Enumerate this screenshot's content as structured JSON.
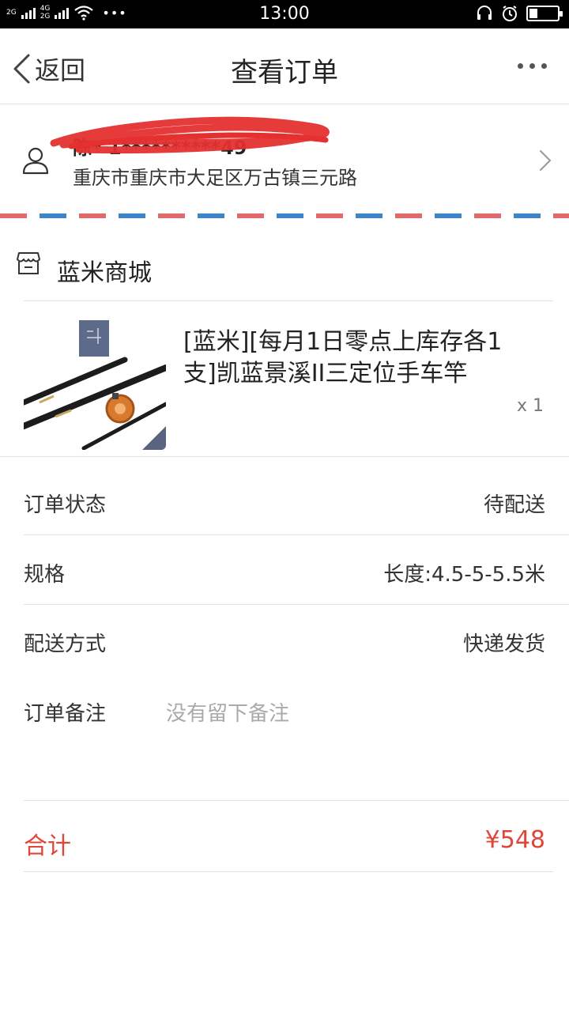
{
  "status_bar": {
    "time": "13:00",
    "net_top": "2G",
    "net2_top": "4G",
    "net2_bottom": "2G",
    "dots": "•••",
    "battery_level": 0.3
  },
  "nav": {
    "back_label": "返回",
    "title": "查看订单"
  },
  "address": {
    "name_phone": "陈*  1**********49",
    "detail": "重庆市重庆市大足区万古镇三元路"
  },
  "shop": {
    "name": "蓝米商城"
  },
  "product": {
    "title": "[蓝米][每月1日零点上库存各1支]凯蓝景溪II三定位手车竿",
    "quantity": "x 1"
  },
  "details": [
    {
      "label": "订单状态",
      "value": "待配送"
    },
    {
      "label": "规格",
      "value": "长度:4.5-5-5.5米"
    },
    {
      "label": "配送方式",
      "value": "快递发货"
    }
  ],
  "remark": {
    "label": "订单备注",
    "placeholder": "没有留下备注"
  },
  "total": {
    "label": "合计",
    "value": "¥548"
  },
  "colors": {
    "accent_red": "#e0453a",
    "stripe_red": "#e16a6a",
    "stripe_blue": "#3a86c8"
  }
}
